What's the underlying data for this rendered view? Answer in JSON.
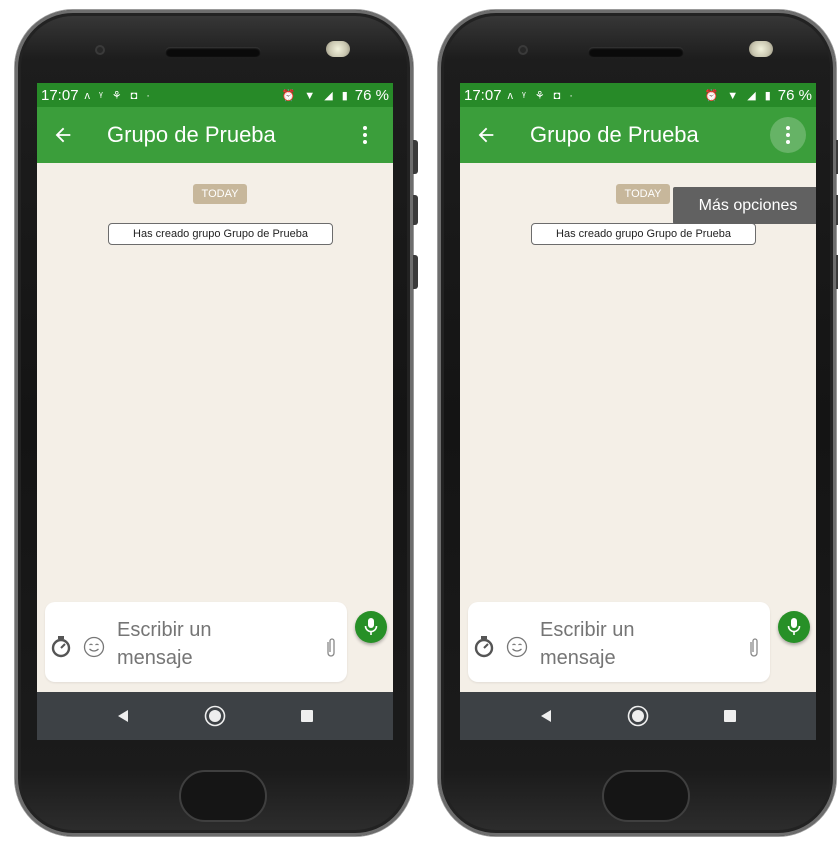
{
  "screens": [
    {
      "id": "left",
      "status_bar": {
        "time": "17:07",
        "left_icons": "ᴧ ᵞ ⚘ ◘ ·",
        "right_icons": "⏰ ▼ ◢ ▮",
        "battery": "76 %"
      },
      "app_bar": {
        "back_icon": "arrow-left-icon",
        "title": "Grupo de Prueba",
        "menu_icon": "more-vert-icon"
      },
      "chat": {
        "date_chip": "TODAY",
        "system_message": "Has creado grupo Grupo de Prueba"
      },
      "input": {
        "placeholder": "Escribir un mensaje"
      }
    },
    {
      "id": "right",
      "status_bar": {
        "time": "17:07",
        "left_icons": "ᴧ ᵞ ⚘ ◘ ·",
        "right_icons": "⏰ ▼ ◢ ▮",
        "battery": "76 %"
      },
      "app_bar": {
        "back_icon": "arrow-left-icon",
        "title": "Grupo de Prueba",
        "menu_icon": "more-vert-icon"
      },
      "chat": {
        "date_chip": "TODAY",
        "system_message": "Has creado grupo Grupo de Prueba"
      },
      "tooltip": "Más opciones",
      "input": {
        "placeholder": "Escribir un mensaje"
      }
    }
  ],
  "colors": {
    "status_bar": "#278a28",
    "app_bar": "#3b9e3b",
    "chat_bg": "#f4efe7",
    "mic_button": "#279027",
    "date_chip": "#c7b79b",
    "tooltip": "#616161"
  }
}
